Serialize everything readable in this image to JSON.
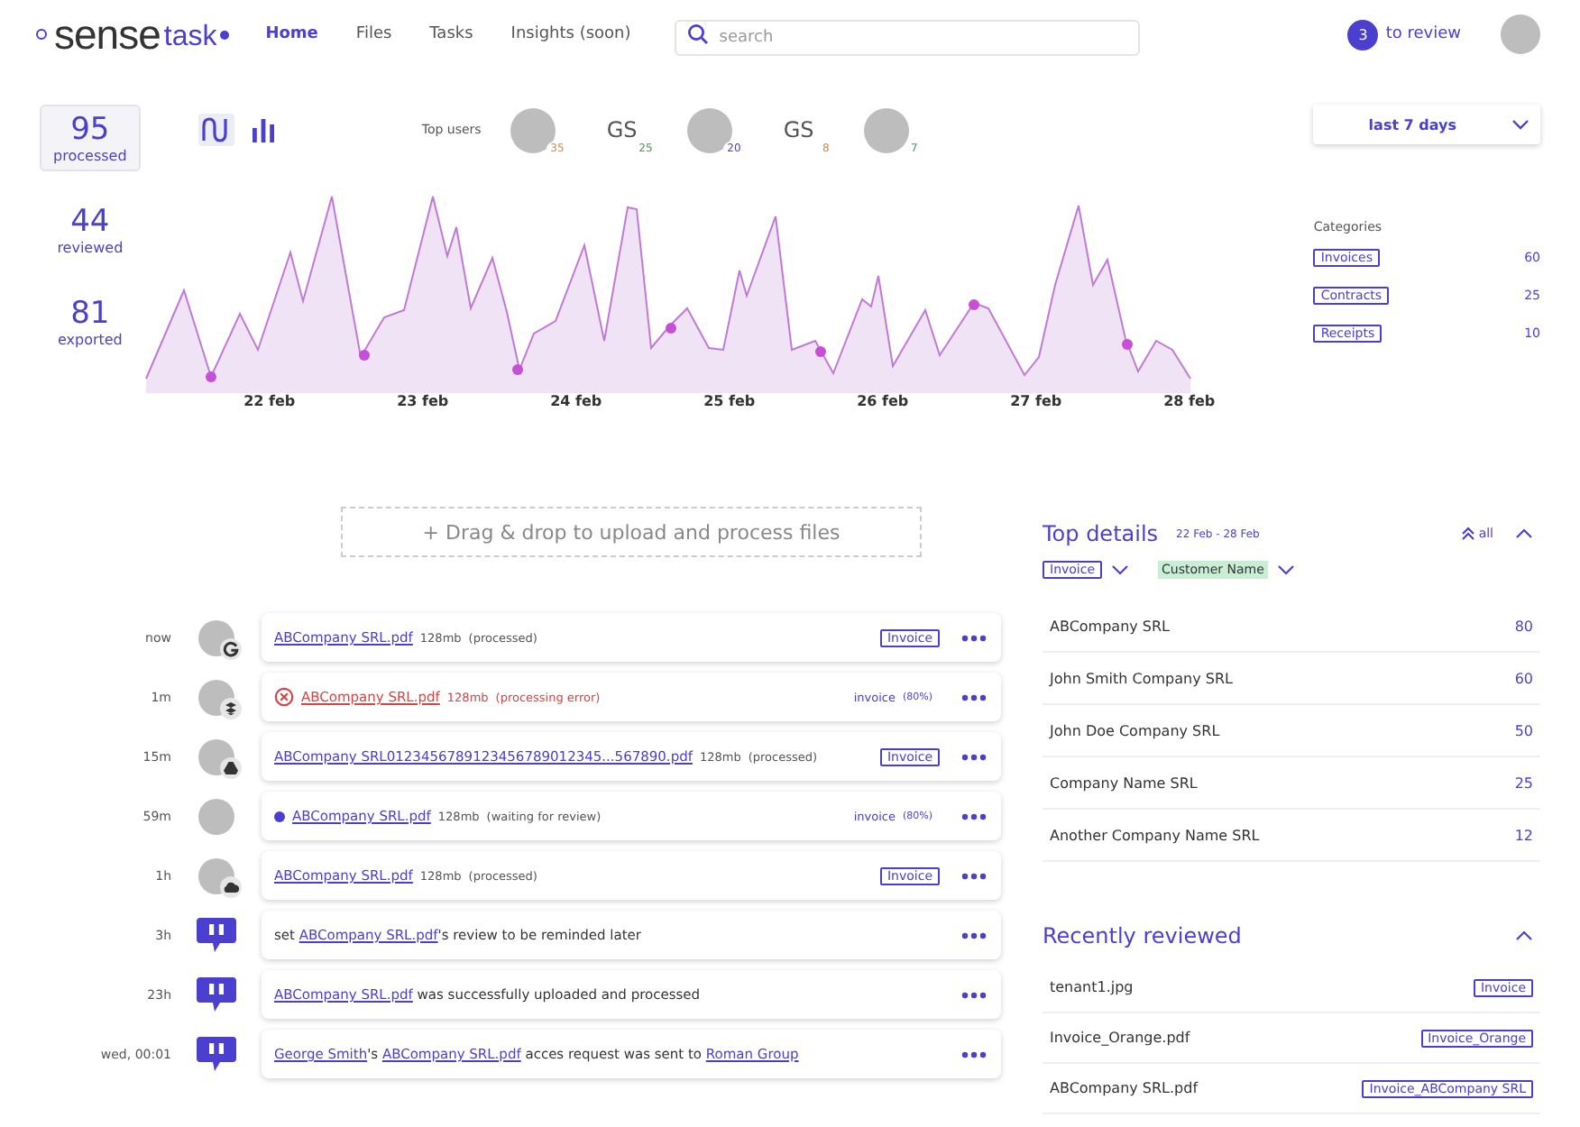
{
  "header": {
    "logo": {
      "word1": "sense",
      "word2": "task"
    },
    "nav": [
      {
        "label": "Home",
        "selected": true
      },
      {
        "label": "Files",
        "selected": false
      },
      {
        "label": "Tasks",
        "selected": false
      },
      {
        "label": "Insights (soon)",
        "selected": false
      }
    ],
    "search": {
      "placeholder": "search"
    },
    "review": {
      "count": "3",
      "label": "to review"
    }
  },
  "stats": [
    {
      "value": "95",
      "label": "processed",
      "selected": true
    },
    {
      "value": "44",
      "label": "reviewed",
      "selected": false
    },
    {
      "value": "81",
      "label": "exported",
      "selected": false
    }
  ],
  "chart_toggle": [
    {
      "kind": "line",
      "selected": true
    },
    {
      "kind": "bar",
      "selected": false
    }
  ],
  "top_users": {
    "label": "Top users",
    "users": [
      {
        "kind": "photo",
        "count": "35",
        "color": "#e0883a"
      },
      {
        "kind": "initials",
        "initials": "GS",
        "count": "25",
        "color": "#43a047"
      },
      {
        "kind": "photo",
        "count": "20",
        "color": "#4b3fd0"
      },
      {
        "kind": "initials",
        "initials": "GS",
        "count": "8",
        "color": "#e0883a"
      },
      {
        "kind": "photo",
        "count": "7",
        "color": "#43a047"
      }
    ]
  },
  "activity_chart": {
    "dates": [
      "22 feb",
      "23 feb",
      "24 feb",
      "25 feb",
      "26 feb",
      "27 feb",
      "28 feb"
    ]
  },
  "period": {
    "value": "last 7 days"
  },
  "categories": {
    "title": "Categories",
    "items": [
      {
        "label": "Invoices",
        "count": "60"
      },
      {
        "label": "Contracts",
        "count": "25"
      },
      {
        "label": "Receipts",
        "count": "10"
      }
    ]
  },
  "upload": {
    "label": "+ Drag & drop to upload and process files"
  },
  "feed": [
    {
      "kind": "file",
      "time": "now",
      "badge": {
        "kind": "google"
      },
      "file": "ABCompany SRL.pdf",
      "size": "128mb",
      "status": "(processed)",
      "error": false,
      "waiting": false,
      "tag": "Invoice",
      "confirmed": true
    },
    {
      "kind": "file",
      "time": "1m",
      "badge": {
        "kind": "dropbox"
      },
      "file": "ABCompany SRL.pdf",
      "size": "128mb",
      "status": "(processing error)",
      "error": true,
      "waiting": false,
      "tag": "invoice",
      "confidence": "(80%)",
      "confirmed": false
    },
    {
      "kind": "file",
      "time": "15m",
      "badge": {
        "kind": "drive"
      },
      "file": "ABCompany SRL0123456789123456789012345...567890.pdf",
      "size": "128mb",
      "status": "(processed)",
      "error": false,
      "waiting": false,
      "tag": "Invoice",
      "confirmed": true
    },
    {
      "kind": "file",
      "time": "59m",
      "file": "ABCompany SRL.pdf",
      "size": "128mb",
      "status": "(waiting for review)",
      "error": false,
      "waiting": true,
      "tag": "invoice",
      "confidence": "(80%)",
      "confirmed": false
    },
    {
      "kind": "file",
      "time": "1h",
      "badge": {
        "kind": "cloud"
      },
      "file": "ABCompany SRL.pdf",
      "size": "128mb",
      "status": "(processed)",
      "error": false,
      "waiting": false,
      "tag": "Invoice",
      "confirmed": true
    },
    {
      "kind": "event",
      "time": "3h",
      "parts": [
        {
          "text": "set ",
          "link": false
        },
        {
          "text": "ABCompany SRL.pdf",
          "link": true
        },
        {
          "text": "'s review to be reminded later",
          "link": false
        }
      ]
    },
    {
      "kind": "event",
      "time": "23h",
      "parts": [
        {
          "text": "ABCompany SRL.pdf",
          "link": true
        },
        {
          "text": " was successfully uploaded and processed",
          "link": false
        }
      ]
    },
    {
      "kind": "event",
      "time": "wed, 00:01",
      "parts": [
        {
          "text": "George Smith",
          "link": true
        },
        {
          "text": "'s ",
          "link": false
        },
        {
          "text": "ABCompany SRL.pdf",
          "link": true
        },
        {
          "text": " acces request was sent to ",
          "link": false
        },
        {
          "text": "Roman Group",
          "link": true
        }
      ]
    }
  ],
  "top_details": {
    "title": "Top details",
    "range": "22 Feb - 28 Feb",
    "all_label": "all",
    "expanded": true,
    "filters": [
      {
        "label": "Invoice",
        "kind": "outlined"
      },
      {
        "label": "Customer Name",
        "kind": "highlighted"
      }
    ],
    "rows": [
      {
        "name": "ABCompany SRL",
        "value": "80"
      },
      {
        "name": "John Smith Company SRL",
        "value": "60"
      },
      {
        "name": "John Doe Company SRL",
        "value": "50"
      },
      {
        "name": "Company Name SRL",
        "value": "25"
      },
      {
        "name": "Another Company Name SRL",
        "value": "12"
      }
    ]
  },
  "recently_reviewed": {
    "title": "Recently reviewed",
    "expanded": true,
    "rows": [
      {
        "name": "tenant1.jpg",
        "tag": "Invoice"
      },
      {
        "name": "Invoice_Orange.pdf",
        "tag": "Invoice_Orange"
      },
      {
        "name": "ABCompany SRL.pdf",
        "tag": "Invoice_ABCompany SRL"
      }
    ]
  }
}
